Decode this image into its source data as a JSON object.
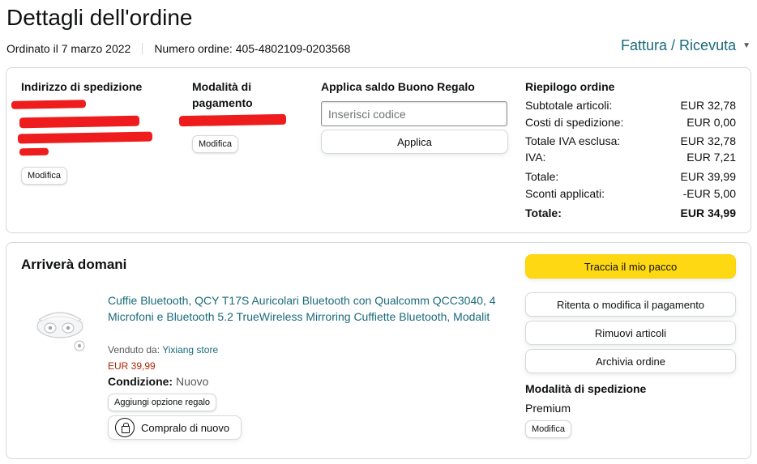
{
  "page": {
    "title": "Dettagli dell'ordine",
    "ordered": "Ordinato il 7 marzo 2022",
    "order_number": "Numero ordine: 405-4802109-0203568",
    "invoice": "Fattura / Ricevuta",
    "invoice_icon": "chevron-down-icon"
  },
  "shipping_address": {
    "heading": "Indirizzo di spedizione",
    "edit": "Modifica"
  },
  "payment": {
    "heading_line1": "Modalità di",
    "heading_line2": "pagamento",
    "edit": "Modifica"
  },
  "gift": {
    "heading": "Applica saldo Buono Regalo",
    "placeholder": "Inserisci codice",
    "apply": "Applica"
  },
  "summary": {
    "heading": "Riepilogo ordine",
    "rows": [
      {
        "label": "Subtotale articoli:",
        "value": "EUR 32,78"
      },
      {
        "label": "Costi di spedizione:",
        "value": "EUR 0,00"
      },
      {
        "label": "Totale IVA esclusa:",
        "value": "EUR 32,78"
      },
      {
        "label": "IVA:",
        "value": "EUR 7,21"
      },
      {
        "label": "Totale:",
        "value": "EUR 39,99"
      },
      {
        "label": "Sconti applicati:",
        "value": "-EUR 5,00"
      },
      {
        "label": "Totale:",
        "value": "EUR 34,99"
      }
    ]
  },
  "shipment": {
    "heading": "Arriverà domani",
    "product_title": "Cuffie Bluetooth, QCY T17S Auricolari Bluetooth con Qualcomm QCC3040, 4 Microfoni e Bluetooth 5.2 TrueWireless Mirroring Cuffiette Bluetooth, Modalit",
    "sold_by_label": "Venduto da:",
    "sold_by_store": "Yixiang store",
    "price": "EUR 39,99",
    "condition_label": "Condizione:",
    "condition_value": "Nuovo",
    "gift_option": "Aggiungi opzione regalo",
    "buy_again": "Compralo di nuovo",
    "buy_again_icon": "buy-again-icon",
    "actions": {
      "track": "Traccia il mio pacco",
      "retry_payment": "Ritenta o modifica il pagamento",
      "remove": "Rimuovi articoli",
      "archive": "Archivia ordine"
    },
    "shipping_mode_heading": "Modalità di spedizione",
    "shipping_mode_value": "Premium",
    "shipping_mode_edit": "Modifica"
  },
  "colors": {
    "link": "#1a6a7a",
    "price": "#b12704",
    "primary_button": "#ffd814",
    "redaction": "#ee1c1c"
  }
}
